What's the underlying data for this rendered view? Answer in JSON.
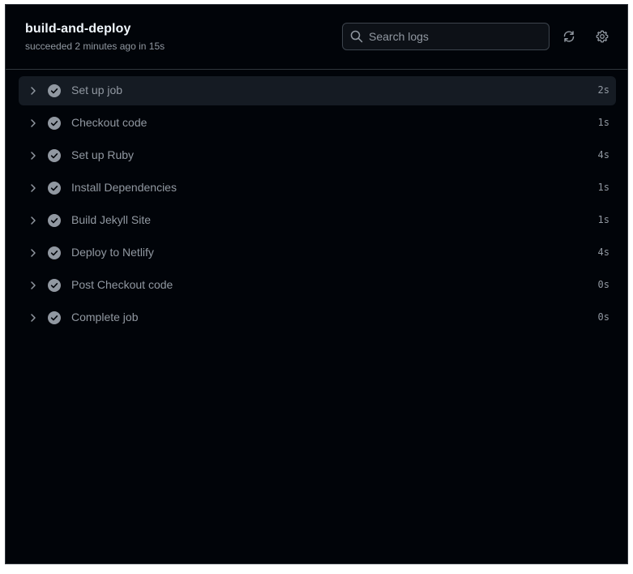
{
  "job": {
    "title": "build-and-deploy",
    "status": "succeeded 2 minutes ago in 15s"
  },
  "search": {
    "placeholder": "Search logs",
    "value": ""
  },
  "toolbar": {
    "refresh_icon": "sync-icon",
    "settings_icon": "gear-icon"
  },
  "colors": {
    "background": "#010409",
    "border": "#30363d",
    "title": "#f0f6fc",
    "muted": "#9198a1",
    "active_row": "#151b23",
    "check": "#9198a1"
  },
  "steps": [
    {
      "name": "Set up job",
      "duration": "2s",
      "status_icon": "check-circle-icon"
    },
    {
      "name": "Checkout code",
      "duration": "1s",
      "status_icon": "check-circle-icon"
    },
    {
      "name": "Set up Ruby",
      "duration": "4s",
      "status_icon": "check-circle-icon"
    },
    {
      "name": "Install Dependencies",
      "duration": "1s",
      "status_icon": "check-circle-icon"
    },
    {
      "name": "Build Jekyll Site",
      "duration": "1s",
      "status_icon": "check-circle-icon"
    },
    {
      "name": "Deploy to Netlify",
      "duration": "4s",
      "status_icon": "check-circle-icon"
    },
    {
      "name": "Post Checkout code",
      "duration": "0s",
      "status_icon": "check-circle-icon"
    },
    {
      "name": "Complete job",
      "duration": "0s",
      "status_icon": "check-circle-icon"
    }
  ]
}
